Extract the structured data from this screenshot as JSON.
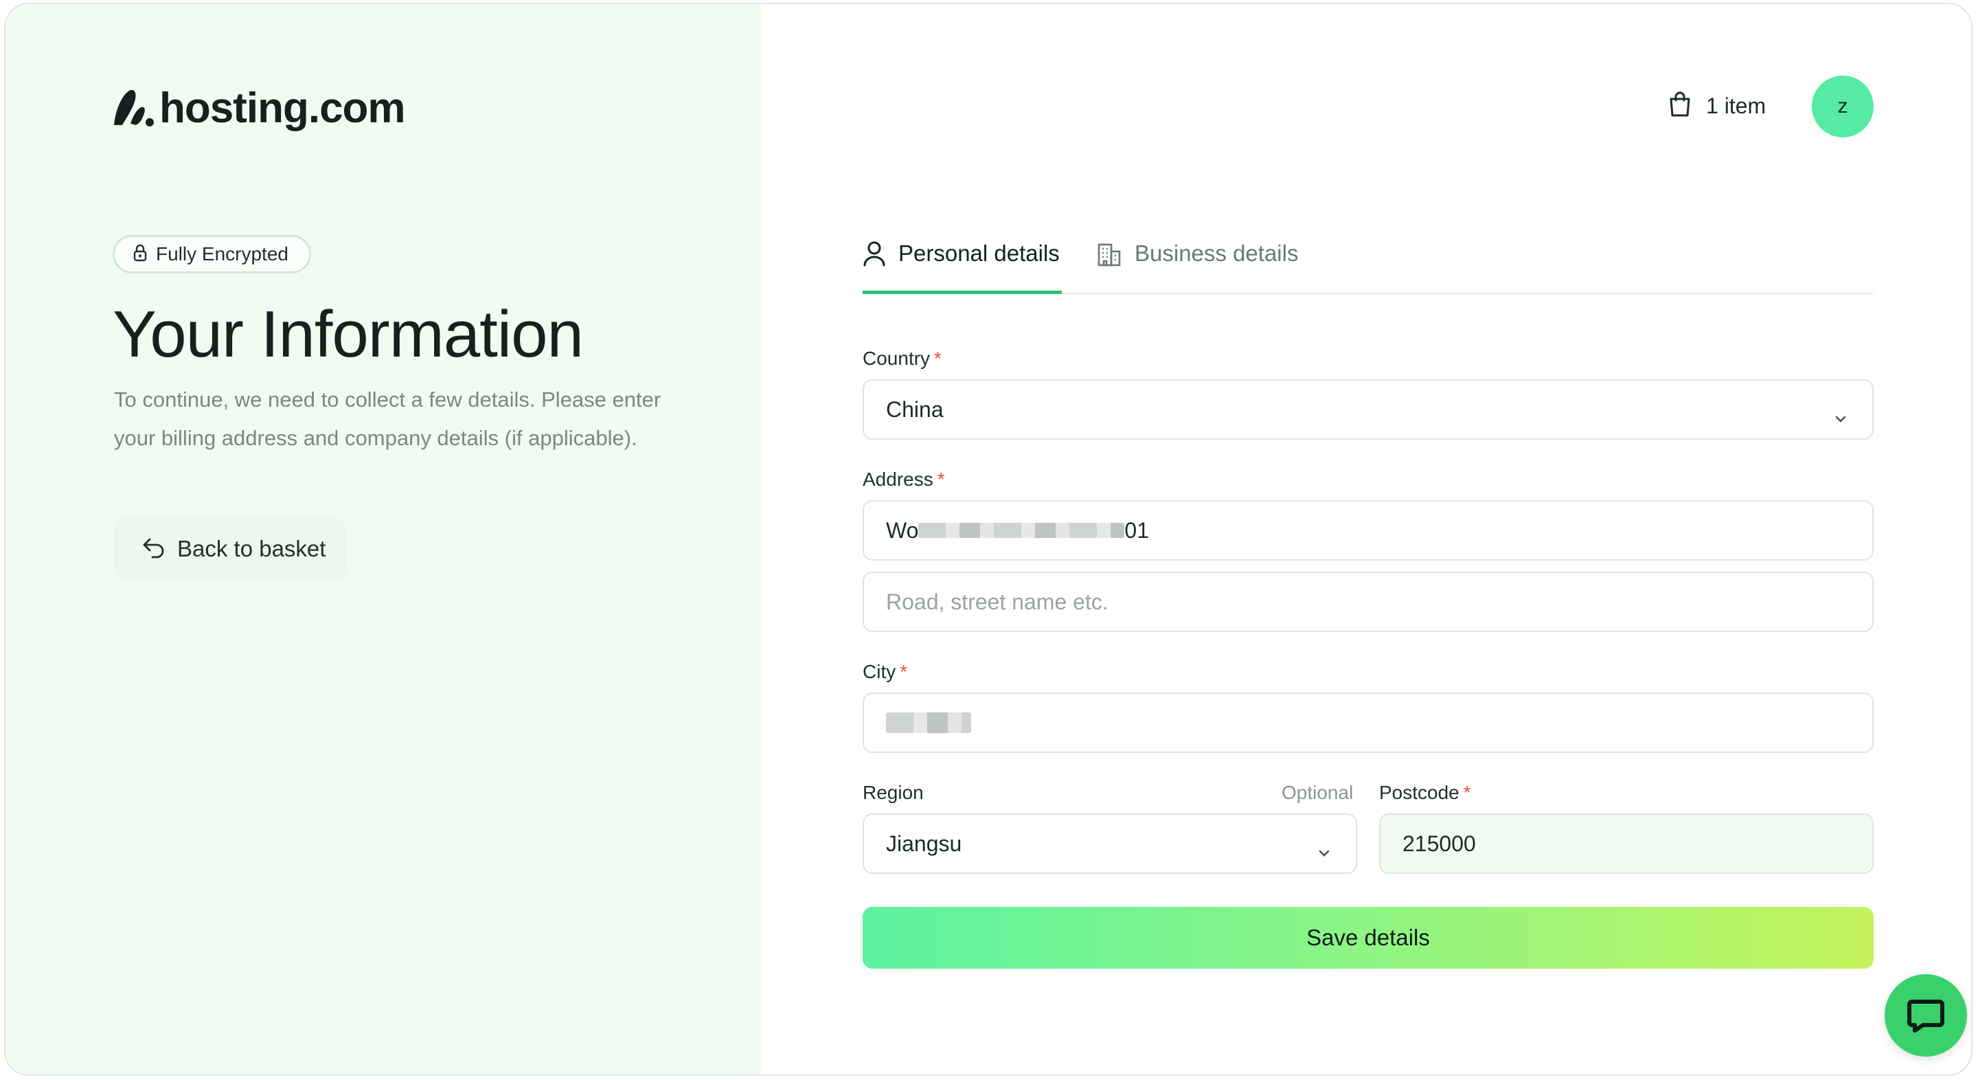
{
  "brand": {
    "name": "hosting.com",
    "logo_icon": "hosting-logo-mark"
  },
  "badge": {
    "label": "Fully Encrypted",
    "icon": "lock-icon"
  },
  "intro": {
    "title": "Your Information",
    "description": "To continue, we need to collect a few details. Please enter your billing address and company details (if applicable)."
  },
  "back": {
    "label": "Back to basket",
    "icon": "undo-arrow-icon"
  },
  "header": {
    "cart_label": "1 item",
    "cart_icon": "shopping-bag-icon",
    "avatar_initial": "z"
  },
  "tabs": [
    {
      "label": "Personal details",
      "icon": "user-icon",
      "active": true
    },
    {
      "label": "Business details",
      "icon": "building-icon",
      "active": false
    }
  ],
  "form": {
    "country": {
      "label": "Country",
      "required": "*",
      "value": "China"
    },
    "address": {
      "label": "Address",
      "required": "*",
      "line1_prefix": "Wo",
      "line1_suffix": "01",
      "line2_placeholder": "Road, street name etc."
    },
    "city": {
      "label": "City",
      "required": "*"
    },
    "region": {
      "label": "Region",
      "optional": "Optional",
      "value": "Jiangsu"
    },
    "postcode": {
      "label": "Postcode",
      "required": "*",
      "value": "215000"
    },
    "submit_label": "Save details"
  },
  "chat": {
    "icon": "chat-bubble-icon"
  },
  "colors": {
    "left_panel_bg": "#f2fbf2",
    "accent_green": "#2cc277",
    "avatar_bg": "#55eba4",
    "required_red": "#e4533a",
    "button_gradient_start": "#5cf2a0",
    "button_gradient_end": "#c4f35b",
    "chat_bg": "#3ad16c"
  }
}
